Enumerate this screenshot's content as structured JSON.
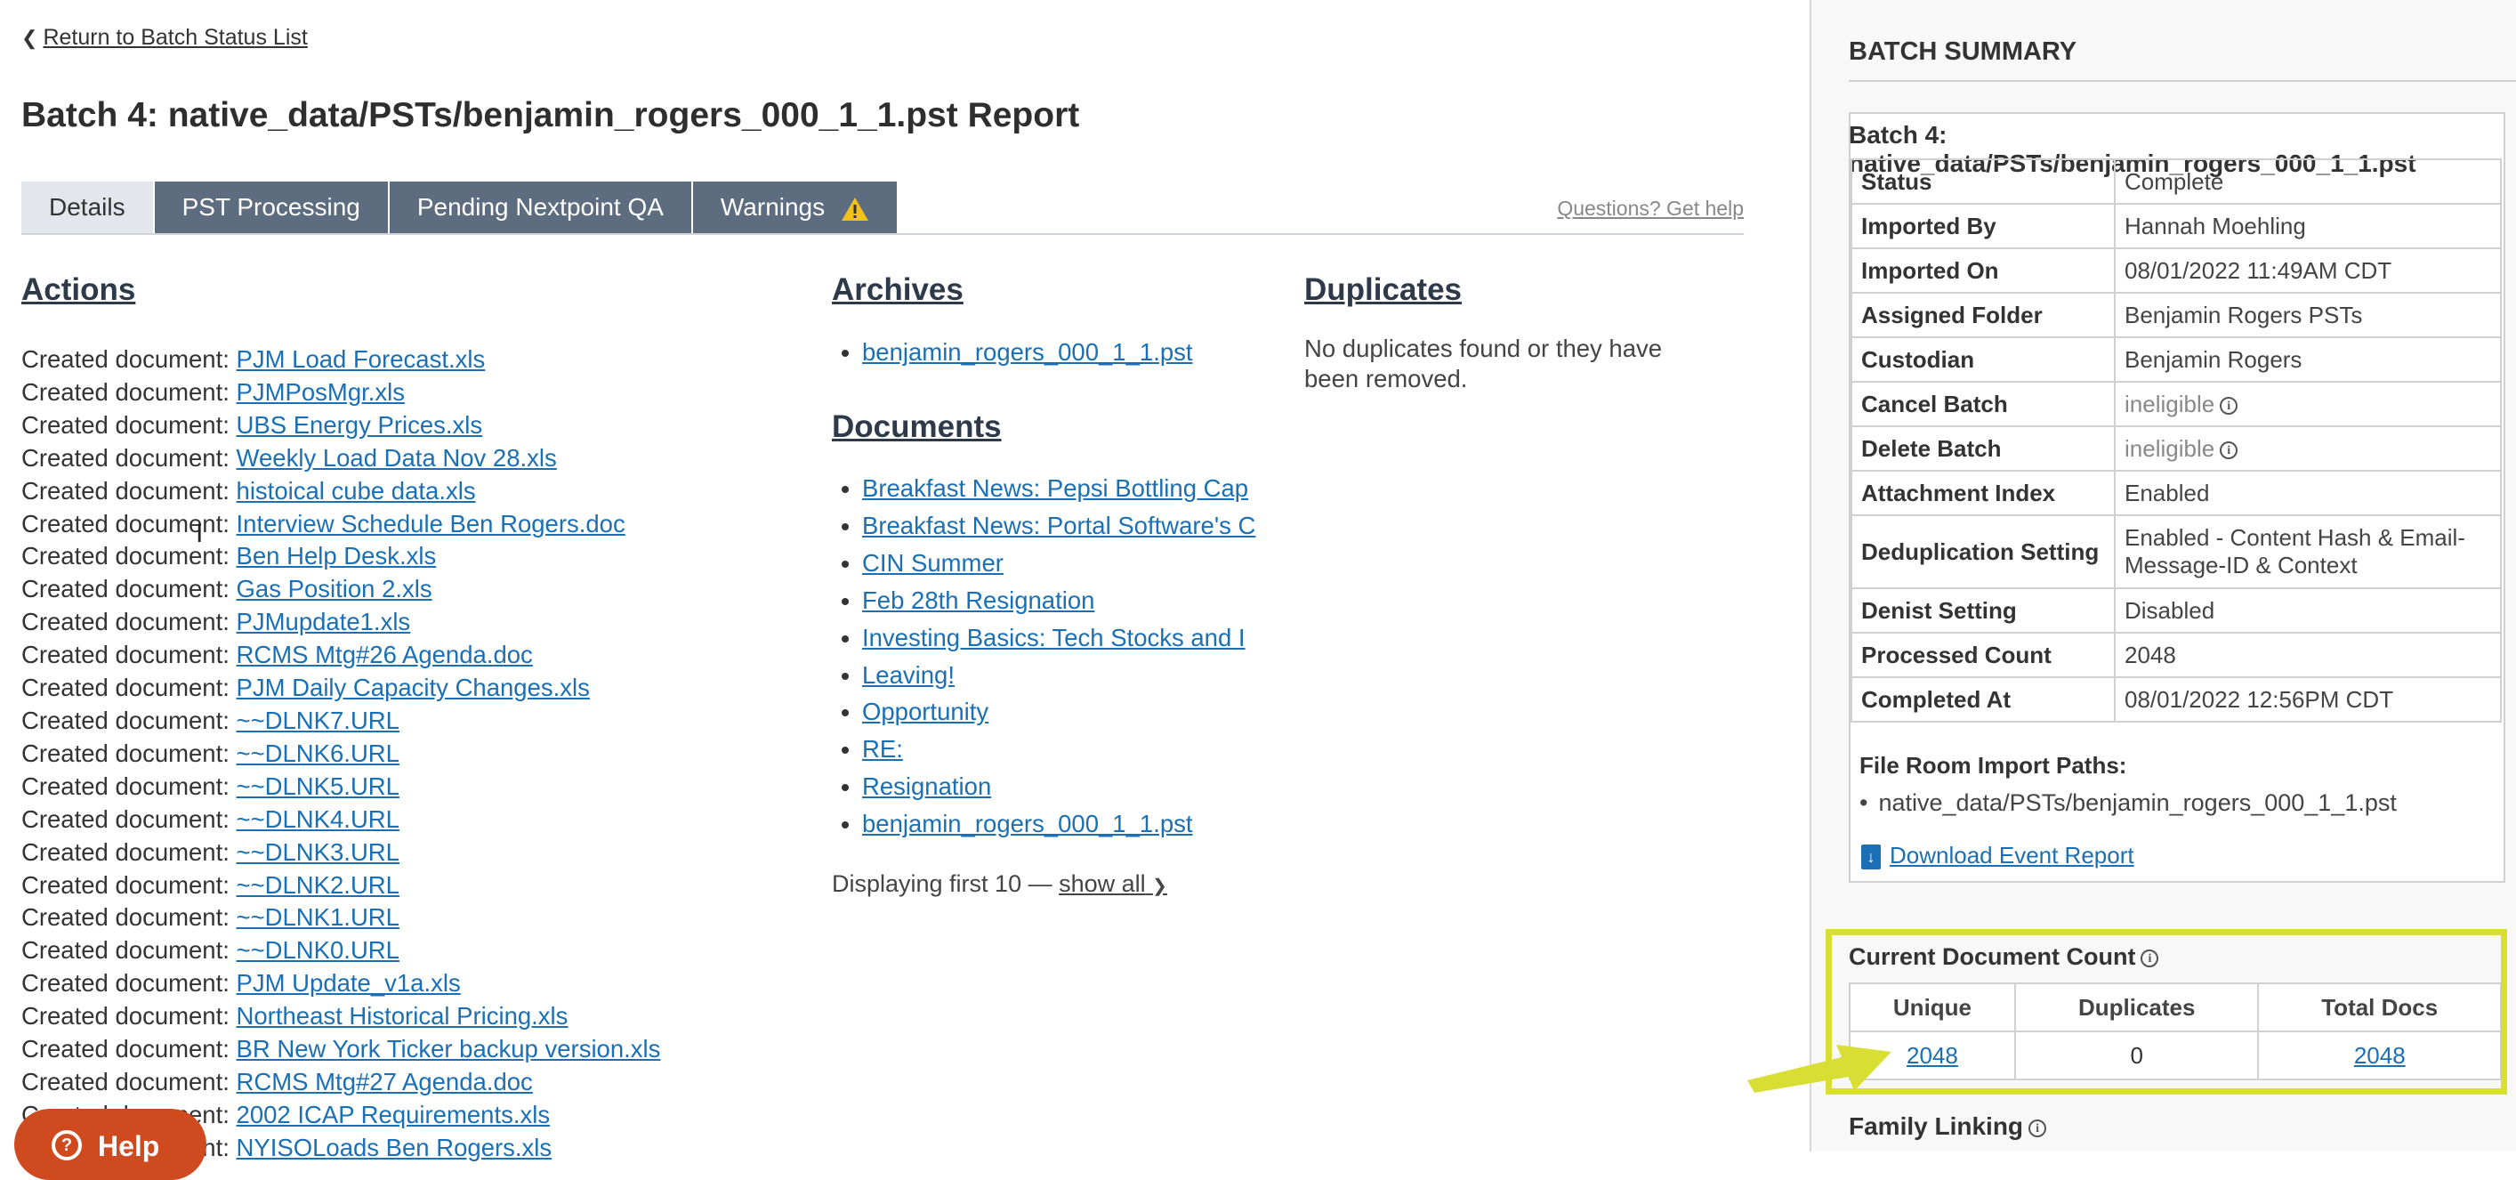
{
  "nav": {
    "back_label": "Return to Batch Status List"
  },
  "page": {
    "title": "Batch 4: native_data/PSTs/benjamin_rogers_000_1_1.pst Report"
  },
  "tabs": [
    {
      "label": "Details",
      "active": true
    },
    {
      "label": "PST Processing"
    },
    {
      "label": "Pending Nextpoint QA"
    },
    {
      "label": "Warnings",
      "icon": "warning-icon"
    }
  ],
  "help_link": "Questions? Get help",
  "actions": {
    "title": "Actions",
    "prefix": "Created document: ",
    "items": [
      "PJM Load Forecast.xls",
      "PJMPosMgr.xls",
      "UBS Energy Prices.xls",
      "Weekly Load Data Nov 28.xls",
      "histoical cube data.xls",
      "Interview Schedule Ben Rogers.doc",
      "Ben Help Desk.xls",
      "Gas Position 2.xls",
      "PJMupdate1.xls",
      "RCMS Mtg#26 Agenda.doc",
      "PJM Daily Capacity Changes.xls",
      "~~DLNK7.URL",
      "~~DLNK6.URL",
      "~~DLNK5.URL",
      "~~DLNK4.URL",
      "~~DLNK3.URL",
      "~~DLNK2.URL",
      "~~DLNK1.URL",
      "~~DLNK0.URL",
      "PJM Update_v1a.xls",
      "Northeast Historical Pricing.xls",
      "BR New York Ticker backup version.xls",
      "RCMS Mtg#27 Agenda.doc",
      "2002 ICAP Requirements.xls",
      "NYISOLoads Ben Rogers.xls"
    ]
  },
  "archives": {
    "title": "Archives",
    "items": [
      "benjamin_rogers_000_1_1.pst"
    ]
  },
  "documents": {
    "title": "Documents",
    "items": [
      "Breakfast News: Pepsi Bottling Cap",
      "Breakfast News: Portal Software's C",
      "CIN Summer",
      "Feb 28th Resignation",
      "Investing Basics: Tech Stocks and I",
      "Leaving!",
      "Opportunity",
      "RE:",
      "Resignation",
      "benjamin_rogers_000_1_1.pst"
    ],
    "displaying": "Displaying first 10 — ",
    "show_all": "show all"
  },
  "duplicates": {
    "title": "Duplicates",
    "text": "No duplicates found or they have been removed."
  },
  "help_button": {
    "label": "Help"
  },
  "summary": {
    "title": "BATCH SUMMARY",
    "batch_name": "Batch 4: native_data/PSTs/benjamin_rogers_000_1_1.pst",
    "rows": [
      {
        "key": "Status",
        "value": "Complete"
      },
      {
        "key": "Imported By",
        "value": "Hannah Moehling"
      },
      {
        "key": "Imported On",
        "value": "08/01/2022 11:49AM CDT"
      },
      {
        "key": "Assigned Folder",
        "value": "Benjamin Rogers PSTs"
      },
      {
        "key": "Custodian",
        "value": "Benjamin Rogers"
      },
      {
        "key": "Cancel Batch",
        "value": "ineligible"
      },
      {
        "key": "Delete Batch",
        "value": "ineligible"
      },
      {
        "key": "Attachment Index",
        "value": "Enabled"
      },
      {
        "key": "Deduplication Setting",
        "value": "Enabled - Content Hash & Email-Message-ID & Context"
      },
      {
        "key": "Denist Setting",
        "value": "Disabled"
      },
      {
        "key": "Processed Count",
        "value": "2048"
      },
      {
        "key": "Completed At",
        "value": "08/01/2022 12:56PM CDT"
      }
    ],
    "file_room_label": "File Room Import Paths:",
    "file_room_path": "native_data/PSTs/benjamin_rogers_000_1_1.pst",
    "download_label": "Download Event Report"
  },
  "doc_count": {
    "title": "Current Document Count",
    "headers": [
      "Unique",
      "Duplicates",
      "Total Docs"
    ],
    "unique": "2048",
    "duplicates": "0",
    "total": "2048"
  },
  "family_linking": {
    "title": "Family Linking"
  },
  "colors": {
    "link": "#1a6fb5",
    "tab": "#5e6c80",
    "highlight": "#d9de35",
    "help": "#cf4a1e"
  }
}
